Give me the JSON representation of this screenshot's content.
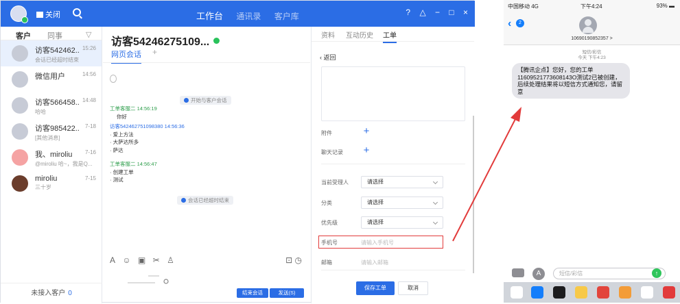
{
  "titlebar": {
    "status_label": "关闭",
    "nav": [
      "工作台",
      "通讯录",
      "客户库"
    ],
    "active_nav": "工作台"
  },
  "sidebar": {
    "tabs": [
      "客户",
      "同事"
    ],
    "contacts": [
      {
        "name": "访客542462...",
        "subtitle": "会话已经超时结束",
        "time": "15:26",
        "selected": true
      },
      {
        "name": "微信用户",
        "subtitle": "",
        "time": "14:56"
      },
      {
        "name": "访客566458...",
        "subtitle": "哈哈",
        "time": "14:48"
      },
      {
        "name": "访客985422...",
        "subtitle": "[其他消息]",
        "time": "7-18"
      },
      {
        "name": "我、miroliu",
        "subtitle": "@miroliu 哈~，我是Q...",
        "time": "7-16"
      },
      {
        "name": "miroliu",
        "subtitle": "三十岁",
        "time": "7-15"
      }
    ],
    "unanswered_label": "未接入客户",
    "unanswered_count": "0"
  },
  "chat": {
    "title": "访客54246275109...",
    "tab_label": "网页会话",
    "tab_add": "+",
    "start_notice": "开始与客户会话",
    "messages": [
      {
        "sender": "工单客服二 14:56:19",
        "kind": "agent",
        "lines": [
          "你好"
        ]
      },
      {
        "sender": "访客542462751098380 14:56:36",
        "kind": "visitor",
        "lines": [
          "· 爱上方法",
          "· 大萨达所多",
          "· 萨达"
        ]
      },
      {
        "sender": "工单客服二 14:56:47",
        "kind": "agent",
        "lines": [
          "· 创建工单",
          "· 测试"
        ]
      }
    ],
    "end_notice": "会话已经超时结束",
    "end_button": "结束会话",
    "send_button": "发送(S)"
  },
  "ticket": {
    "tabs": [
      "资料",
      "互动历史",
      "工单"
    ],
    "active_tab": "工单",
    "back_label": "返回",
    "attachment_label": "附件",
    "chat_record_label": "聊天记录",
    "assignee_label": "当前受理人",
    "assignee_value": "请选择",
    "category_label": "分类",
    "category_value": "请选择",
    "priority_label": "优先级",
    "priority_value": "请选择",
    "phone_label": "手机号",
    "phone_placeholder": "请输入手机号",
    "email_label": "邮箱",
    "email_placeholder": "请输入邮箱",
    "save_button": "保存工单",
    "cancel_button": "取消"
  },
  "phone": {
    "carrier": "中国移动  4G",
    "time": "下午4:24",
    "battery": "93%",
    "back_badge": "2",
    "contact_number": "10690190852357 >",
    "sms_label": "短信/彩信",
    "sms_time": "今天 下午4:23",
    "message": "【腾讯企点】您好，您的工单11609521773608143O测试2已被创建，后续处理结果将以短信方式通知您，请留意",
    "input_placeholder": "短信/彩信"
  },
  "colors": {
    "accent": "#2b6de5",
    "highlight": "#e23b3b",
    "online": "#29c25b"
  }
}
